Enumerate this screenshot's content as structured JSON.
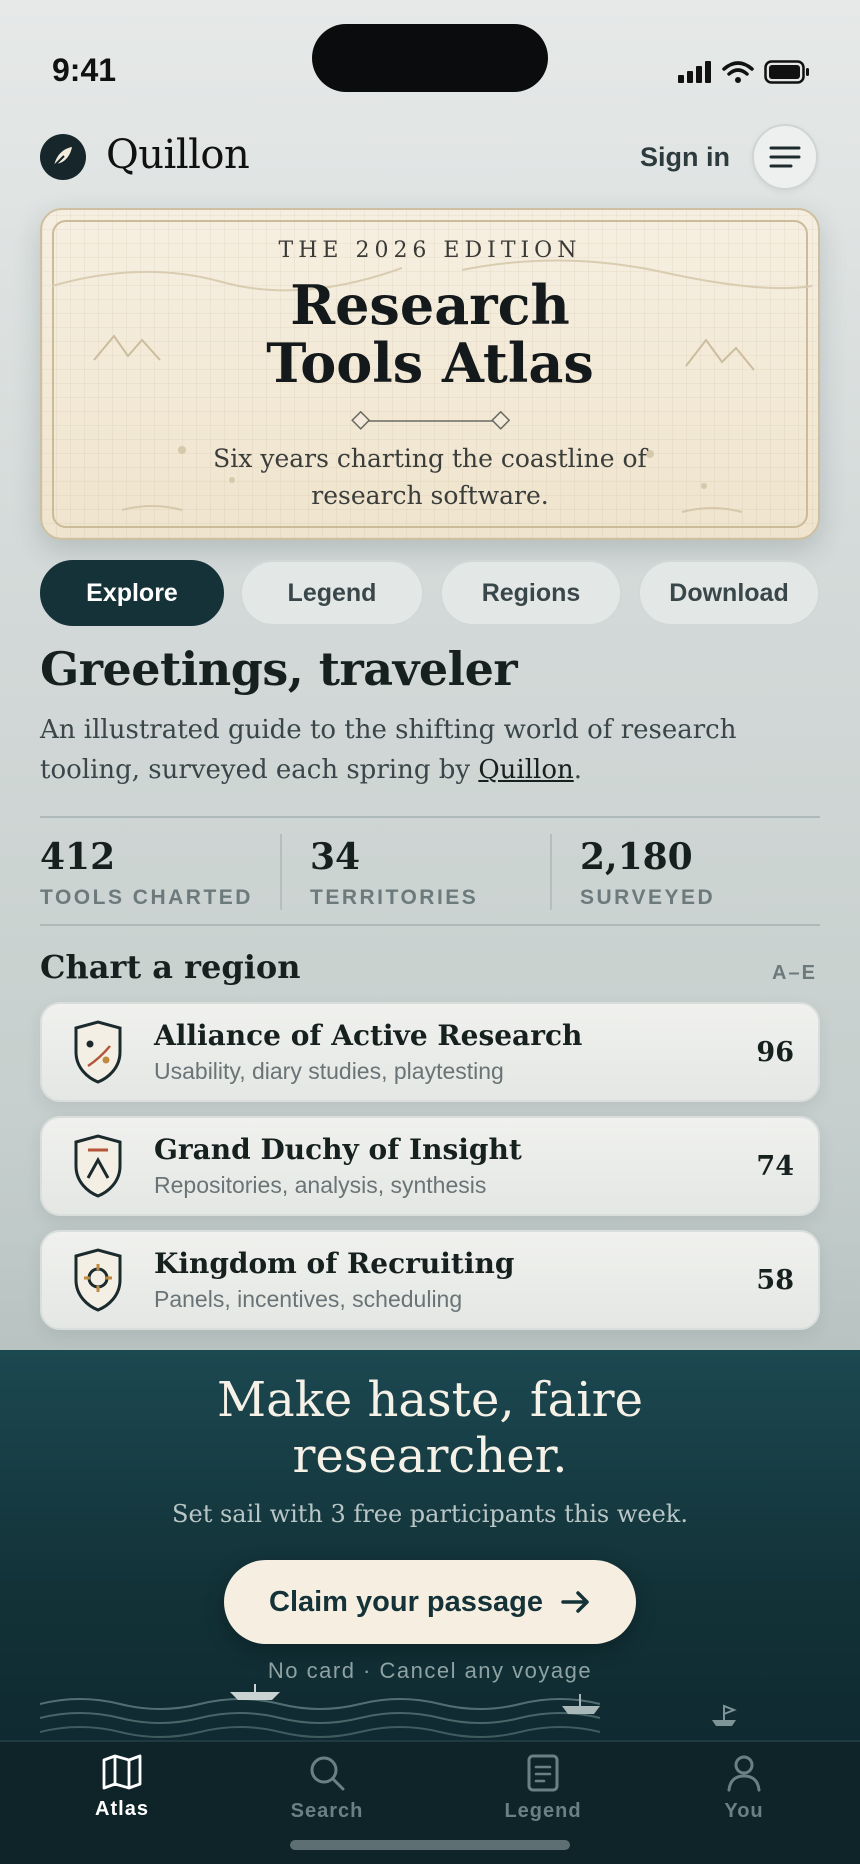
{
  "status_bar": {
    "time": "9:41"
  },
  "header": {
    "brand": "Quillon",
    "sign_in": "Sign in"
  },
  "hero": {
    "eyebrow": "THE 2026 EDITION",
    "title_line1": "Research",
    "title_line2": "Tools Atlas",
    "subtitle_line1": "Six years charting the coastline of",
    "subtitle_line2": "research software."
  },
  "tabs": [
    {
      "label": "Explore",
      "active": true
    },
    {
      "label": "Legend",
      "active": false
    },
    {
      "label": "Regions",
      "active": false
    },
    {
      "label": "Download",
      "active": false
    }
  ],
  "greeting": {
    "title": "Greetings, traveler",
    "intro_before": "An illustrated guide to the shifting world of research tooling, surveyed each spring by ",
    "intro_link": "Quillon",
    "intro_after": "."
  },
  "stats": [
    {
      "value": "412",
      "label": "TOOLS CHARTED"
    },
    {
      "value": "34",
      "label": "TERRITORIES"
    },
    {
      "value": "2,180",
      "label": "SURVEYED"
    }
  ],
  "regions_section": {
    "title": "Chart a region",
    "sort": "A–E"
  },
  "regions": [
    {
      "name": "Alliance of Active Research",
      "desc": "Usability, diary studies, playtesting",
      "score": "96"
    },
    {
      "name": "Grand Duchy of Insight",
      "desc": "Repositories, analysis, synthesis",
      "score": "74"
    },
    {
      "name": "Kingdom of Recruiting",
      "desc": "Panels, incentives, scheduling",
      "score": "58"
    }
  ],
  "promo": {
    "title_line1": "Make haste, faire",
    "title_line2": "researcher.",
    "subtitle": "Set sail with 3 free participants this week.",
    "cta": "Claim your passage",
    "note": "No card · Cancel any voyage"
  },
  "bottom_nav": [
    {
      "label": "Atlas",
      "icon": "map-icon",
      "active": true
    },
    {
      "label": "Search",
      "icon": "search-icon",
      "active": false
    },
    {
      "label": "Legend",
      "icon": "document-icon",
      "active": false
    },
    {
      "label": "You",
      "icon": "person-icon",
      "active": false
    }
  ],
  "colors": {
    "primary": "#143238",
    "parchment": "#f6efe1",
    "accent_gold": "#c08a3e"
  }
}
